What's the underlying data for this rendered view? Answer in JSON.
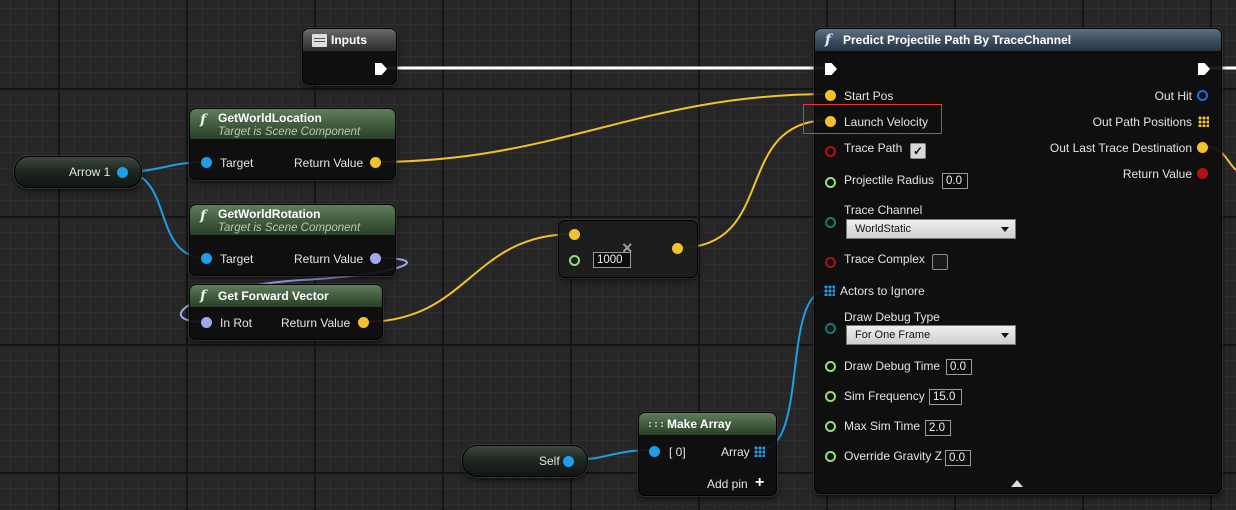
{
  "colors": {
    "vector": "#f2c12e",
    "object": "#1c9ee8",
    "rotator": "#a0a8f0",
    "bool": "#b01212",
    "float": "#8fe36a",
    "byte": "#0f7d6f",
    "hit_struct": "#1b6fe0",
    "exec": "#ffffff"
  },
  "nodes": {
    "inputs": {
      "title": "Inputs",
      "icon": "document-icon"
    },
    "get_world_location": {
      "title": "GetWorldLocation",
      "subtitle": "Target is Scene Component",
      "in_target": "Target",
      "out_return": "Return Value"
    },
    "get_world_rotation": {
      "title": "GetWorldRotation",
      "subtitle": "Target is Scene Component",
      "in_target": "Target",
      "out_return": "Return Value"
    },
    "get_forward_vector": {
      "title": "Get Forward Vector",
      "in_rot": "In Rot",
      "out_return": "Return Value"
    },
    "arrow_var": {
      "label": "Arrow 1"
    },
    "self_var": {
      "label": "Self"
    },
    "multiply": {
      "value": "1000",
      "operator": "×"
    },
    "make_array": {
      "title": "Make Array",
      "in0": "[ 0]",
      "out_array": "Array",
      "add_pin": "Add pin"
    },
    "predict": {
      "title": "Predict Projectile Path By TraceChannel",
      "inputs": {
        "start_pos": "Start Pos",
        "launch_velocity": "Launch Velocity",
        "trace_path": "Trace Path",
        "projectile_radius": "Projectile Radius",
        "projectile_radius_value": "0.0",
        "trace_channel": "Trace Channel",
        "trace_channel_value": "WorldStatic",
        "trace_complex": "Trace Complex",
        "actors_to_ignore": "Actors to Ignore",
        "draw_debug_type": "Draw Debug Type",
        "draw_debug_type_value": "For One Frame",
        "draw_debug_time": "Draw Debug Time",
        "draw_debug_time_value": "0.0",
        "sim_frequency": "Sim Frequency",
        "sim_frequency_value": "15.0",
        "max_sim_time": "Max Sim Time",
        "max_sim_time_value": "2.0",
        "override_gravity_z": "Override Gravity Z",
        "override_gravity_z_value": "0.0"
      },
      "outputs": {
        "out_hit": "Out Hit",
        "out_path_positions": "Out Path Positions",
        "out_last_trace_destination": "Out Last Trace Destination",
        "return_value": "Return Value"
      },
      "trace_path_checked": true,
      "trace_complex_checked": false
    }
  }
}
